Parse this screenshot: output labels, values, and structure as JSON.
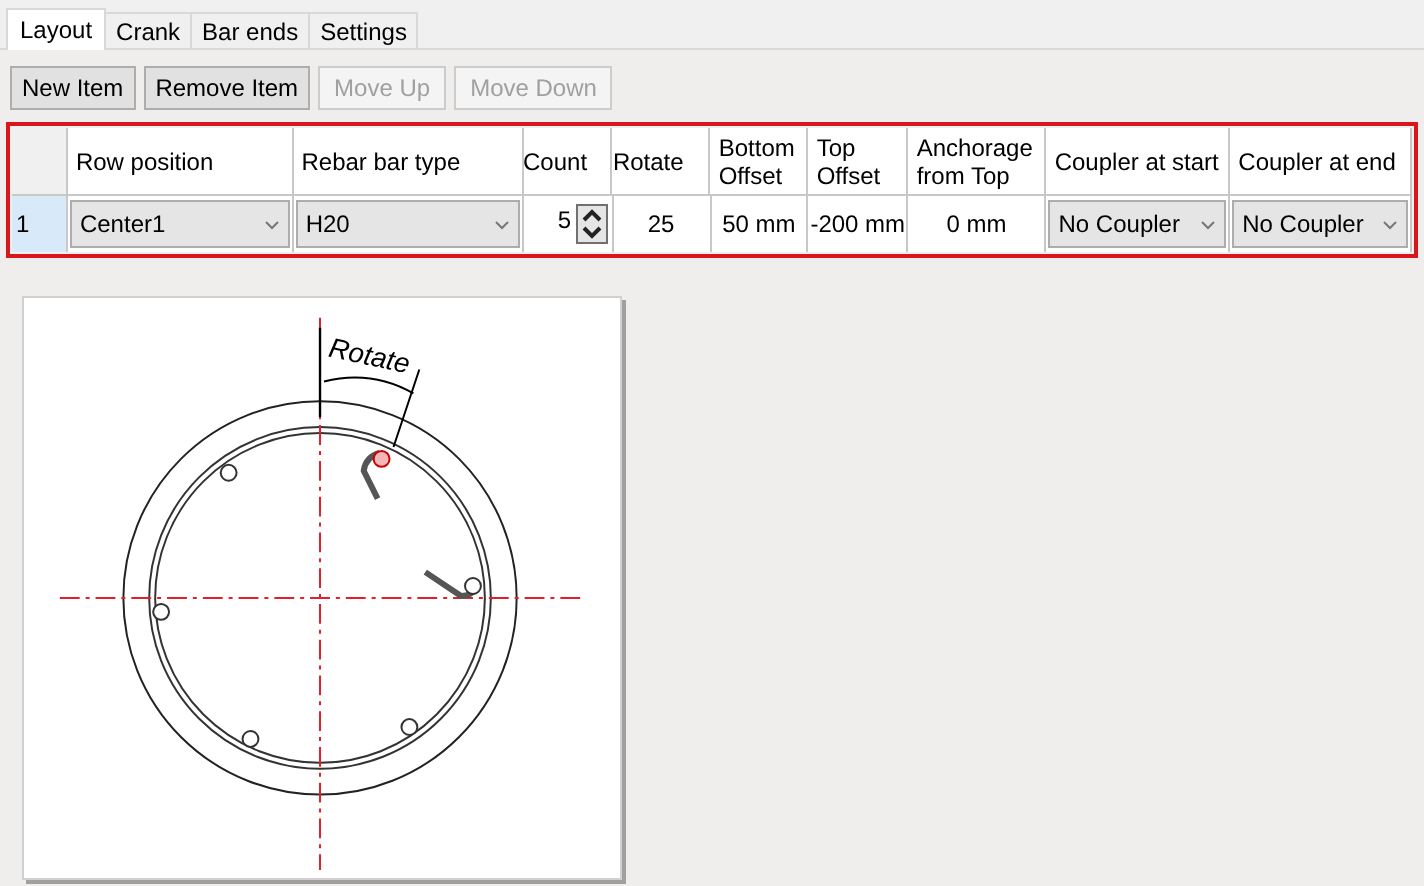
{
  "tabs": [
    {
      "label": "Layout",
      "selected": true
    },
    {
      "label": "Crank",
      "selected": false
    },
    {
      "label": "Bar ends",
      "selected": false
    },
    {
      "label": "Settings",
      "selected": false
    }
  ],
  "toolbar": [
    {
      "label": "New Item",
      "disabled": false
    },
    {
      "label": "Remove Item",
      "disabled": false
    },
    {
      "label": "Move Up",
      "disabled": true
    },
    {
      "label": "Move Down",
      "disabled": true
    }
  ],
  "table": {
    "columns": [
      "Row position",
      "Rebar bar type",
      "Count",
      "Rotate",
      "Bottom Offset",
      "Top Offset",
      "Anchorage from Top",
      "Coupler at start",
      "Coupler at end"
    ],
    "rows": [
      {
        "header": "1",
        "selected": true,
        "cells": [
          {
            "kind": "dropdown",
            "value": "Center1"
          },
          {
            "kind": "dropdown",
            "value": "H20"
          },
          {
            "kind": "spinner",
            "value": "5"
          },
          {
            "kind": "text",
            "value": "25"
          },
          {
            "kind": "text",
            "value": "50 mm"
          },
          {
            "kind": "text",
            "value": "-200 mm"
          },
          {
            "kind": "text",
            "value": "0 mm"
          },
          {
            "kind": "dropdown",
            "value": "No Coupler"
          },
          {
            "kind": "dropdown",
            "value": "No Coupler"
          }
        ]
      }
    ]
  },
  "diagram": {
    "label": "Rotate"
  }
}
